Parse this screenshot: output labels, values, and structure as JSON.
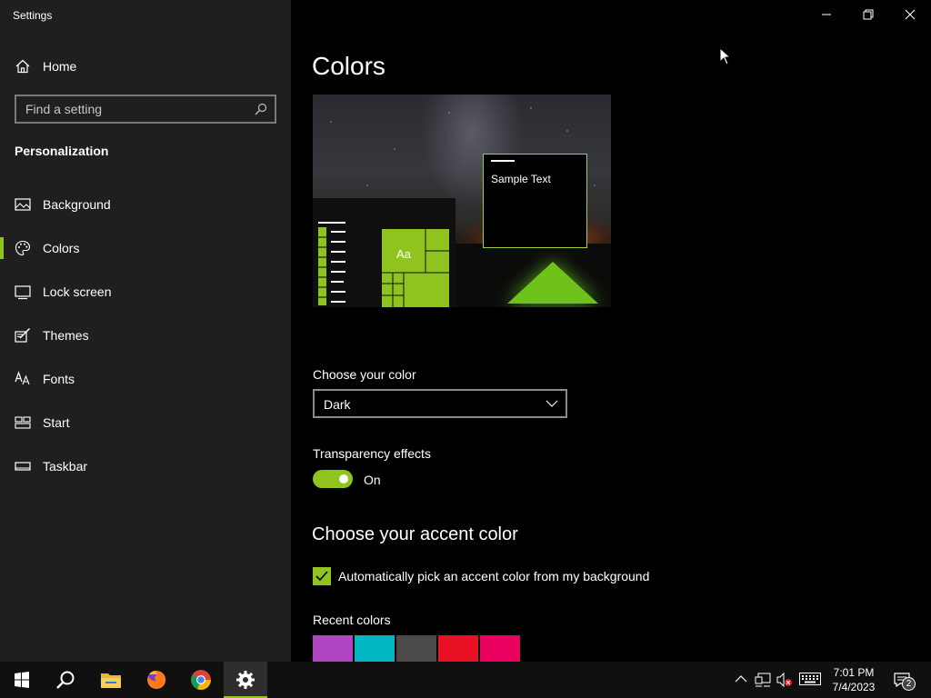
{
  "app": {
    "title": "Settings"
  },
  "window_controls": {
    "minimize": "minimize-icon",
    "restore": "restore-icon",
    "close": "close-icon"
  },
  "sidebar": {
    "home_label": "Home",
    "search_placeholder": "Find a setting",
    "section_heading": "Personalization",
    "items": [
      {
        "label": "Background",
        "icon": "picture-icon"
      },
      {
        "label": "Colors",
        "icon": "palette-icon",
        "selected": true
      },
      {
        "label": "Lock screen",
        "icon": "lock-screen-icon"
      },
      {
        "label": "Themes",
        "icon": "themes-icon"
      },
      {
        "label": "Fonts",
        "icon": "fonts-icon"
      },
      {
        "label": "Start",
        "icon": "start-icon"
      },
      {
        "label": "Taskbar",
        "icon": "taskbar-icon"
      }
    ]
  },
  "main": {
    "page_title": "Colors",
    "preview": {
      "sample_text": "Sample Text",
      "tile_label": "Aa"
    },
    "choose_color": {
      "label": "Choose your color",
      "selected": "Dark"
    },
    "transparency": {
      "label": "Transparency effects",
      "state": "On",
      "enabled": true
    },
    "accent": {
      "heading": "Choose your accent color",
      "auto_pick_label": "Automatically pick an accent color from my background",
      "auto_pick_checked": true,
      "recent_colors_label": "Recent colors",
      "recent_colors": [
        "#b146c2",
        "#00b7c3",
        "#4c4a48",
        "#e81123",
        "#ea005e"
      ],
      "current_accent": "#8fc41f"
    }
  },
  "taskbar": {
    "apps": [
      "start-icon",
      "search-icon",
      "file-explorer-icon",
      "firefox-icon",
      "chrome-icon",
      "settings-icon"
    ],
    "time": "7:01 PM",
    "date": "7/4/2023",
    "notification_count": "2"
  }
}
